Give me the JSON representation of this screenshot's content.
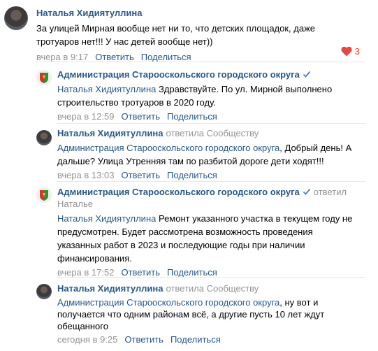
{
  "top_comment": {
    "author": "Наталья Хидиятуллина",
    "text_line1": "За улицей Мирная вообще нет ни то, что детских площадок, даже",
    "text_line2": "тротуаров нет!!! У нас детей вообще нет))",
    "time": "вчера в 9:17",
    "reply_label": "Ответить",
    "share_label": "Поделиться",
    "likes": "3"
  },
  "replies": [
    {
      "author": "Администрация Старооскольского городского округа",
      "mention": "Наталья Хидиятуллина",
      "text_line1_rest": " Здравствуйте. По ул. Мирной выполнено",
      "text_line2": "строительство тротуаров в 2020 году.",
      "time": "вчера в 12:59",
      "reply_label": "Ответить",
      "share_label": "Поделиться"
    },
    {
      "author": "Наталья Хидиятуллина",
      "replied_to": "ответила Сообществу",
      "mention": "Администрация Старооскольского городского округа",
      "text_line1_rest": ", Добрый день! А",
      "text_line2": "дальше? Улица Утренняя там по разбитой дороге дети ходят!!!",
      "time": "вчера в 13:03",
      "reply_label": "Ответить",
      "share_label": "Поделиться"
    },
    {
      "author": "Администрация Старооскольского городского округа",
      "replied_to_line1": "ответил",
      "replied_to_line2": "Наталье",
      "mention": "Наталья Хидиятуллина",
      "text_line1_rest": " Ремонт указанного участка в текущем году не",
      "text_line2": "предусмотрен. Будет рассмотрена возможность проведения",
      "text_line3": "указанных работ в 2023 и последующие годы при наличии",
      "text_line4": "финансирования.",
      "time": "вчера в 17:52",
      "reply_label": "Ответить",
      "share_label": "Поделиться"
    },
    {
      "author": "Наталья Хидиятуллина",
      "replied_to": "ответила Сообществу",
      "mention": "Администрация Старооскольского городского округа",
      "text_line1_rest": ", ну вот и",
      "text_line2": "получается что одним районам всё, а другие пусть 10 лет ждут",
      "text_line3": "обещанного",
      "time": "сегодня в 9:25",
      "reply_label": "Ответить",
      "share_label": "Поделиться"
    }
  ],
  "colors": {
    "link": "#2a5885",
    "meta": "#939393",
    "like": "#e64646",
    "verified": "#5181b8"
  }
}
